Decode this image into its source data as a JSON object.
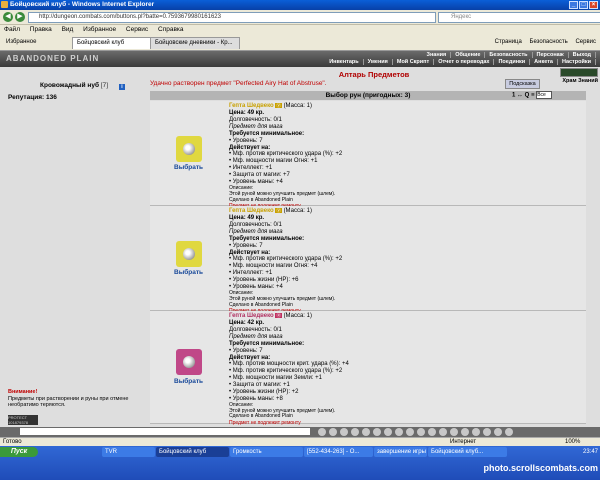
{
  "window": {
    "title": "Бойцовский клуб - Windows Internet Explorer"
  },
  "address": {
    "url": "http://dungeon.combats.com/buttons.pl?batte=0.7593679980161623",
    "search_placeholder": "Яндекс"
  },
  "menu": [
    "Файл",
    "Правка",
    "Вид",
    "Избранное",
    "Сервис",
    "Справка"
  ],
  "tabs": {
    "favorites": "Избранное",
    "tab1": "Бойцовский клуб",
    "tab2": "Бойцовские дневники - Кр...",
    "tools": [
      "Страница",
      "Безопасность",
      "Сервис"
    ]
  },
  "game": {
    "logo": "ABANDONED PLAIN",
    "nav_row1": [
      "Знания",
      "Общение",
      "Безопасность",
      "Персонаж",
      "Выход"
    ],
    "nav_row2": [
      "Инвентарь",
      "Умения",
      "Мой Скрипт",
      "Отчет о переводах",
      "Поединки",
      "Анкета",
      "Настройки"
    ]
  },
  "left": {
    "char_name": "Кровожадный нуб",
    "char_level": "[7]",
    "reputation": "Репутация: 136",
    "warning_title": "Внимание!",
    "warning_text": "Предметы при растворении и руны при отмене необратимо теряются.",
    "counter": "PROTECT 101879378"
  },
  "main": {
    "title": "Алтарь Предметов",
    "success": "Удачно растворен предмет \"Perfected Airy Hat of Abstruse\".",
    "hint_button": "Подсказка",
    "clock_label": "Храм Знаний",
    "list_header": "Выбор рун (пригодных: 3)",
    "list_tools": "1 ↔ Q ≡",
    "select_value": "Все",
    "pick_label": "Выбрать",
    "items": [
      {
        "name": "Гепта Шедвеко",
        "mass": "(Масса: 1)",
        "price": "Цена: 49 кр.",
        "durability": "Долговечность: 0/1",
        "purpose": "Предмет для мага",
        "req_title": "Требуется минимальное:",
        "req": [
          "• Уровень: 7"
        ],
        "acts_title": "Действует на:",
        "acts": [
          "• Мф. против критического удара (%): +2",
          "• Мф. мощности магии Огня: +1",
          "• Интеллект: +1",
          "• Защита от магии: +7",
          "• Уровень маны: +4"
        ],
        "desc_title": "Описание:",
        "desc": "Этой руной можно улучшить предмет (шлем).",
        "made": "Сделано в Abandoned Plain",
        "repair": "Предмет не подлежит ремонту"
      },
      {
        "name": "Гепта Шедвеко",
        "mass": "(Масса: 1)",
        "price": "Цена: 49 кр.",
        "durability": "Долговечность: 0/1",
        "purpose": "Предмет для мага",
        "req_title": "Требуется минимальное:",
        "req": [
          "• Уровень: 7"
        ],
        "acts_title": "Действует на:",
        "acts": [
          "• Мф. против критического удара (%): +2",
          "• Мф. мощности магии Огня: +4",
          "• Интеллект: +1",
          "• Уровень жизни (HP): +6",
          "• Уровень маны: +4"
        ],
        "desc_title": "Описание:",
        "desc": "Этой руной можно улучшить предмет (шлем).",
        "made": "Сделано в Abandoned Plain",
        "repair": "Предмет не подлежит ремонту"
      },
      {
        "name": "Гепта Шедвеко",
        "mass": "(Масса: 1)",
        "price": "Цена: 42 кр.",
        "durability": "Долговечность: 0/1",
        "purpose": "Предмет для мага",
        "req_title": "Требуется минимальное:",
        "req": [
          "• Уровень: 7"
        ],
        "acts_title": "Действует на:",
        "acts": [
          "• Мф. против мощности крит. удара (%): +4",
          "• Мф. против критического удара (%): +2",
          "• Мф. мощности магии Земли: +1",
          "• Защита от магии: +1",
          "• Уровень жизни (HP): +2",
          "• Уровень маны: +8"
        ],
        "desc_title": "Описание:",
        "desc": "Этой руной можно улучшить предмет (шлем).",
        "made": "Сделано в Abandoned Plain",
        "repair": "Предмет не подлежит ремонту"
      }
    ]
  },
  "status": {
    "left": "Готово",
    "zone": "Интернет",
    "zoom": "100%"
  },
  "taskbar": {
    "start": "Пуск",
    "tasks": [
      "TVR",
      "Бойцовский клуб",
      "Громкость",
      "[552-434-263] - О...",
      "завершение игры",
      "Бойцовский клуб..."
    ],
    "clock": "23:47",
    "watermark": "photo.scrollscombats.com"
  },
  "colors": {
    "gold_badge": "#c8a000",
    "pink_badge": "#c03060",
    "item1_bg": "#e0d840",
    "item3_bg": "#c04888"
  }
}
